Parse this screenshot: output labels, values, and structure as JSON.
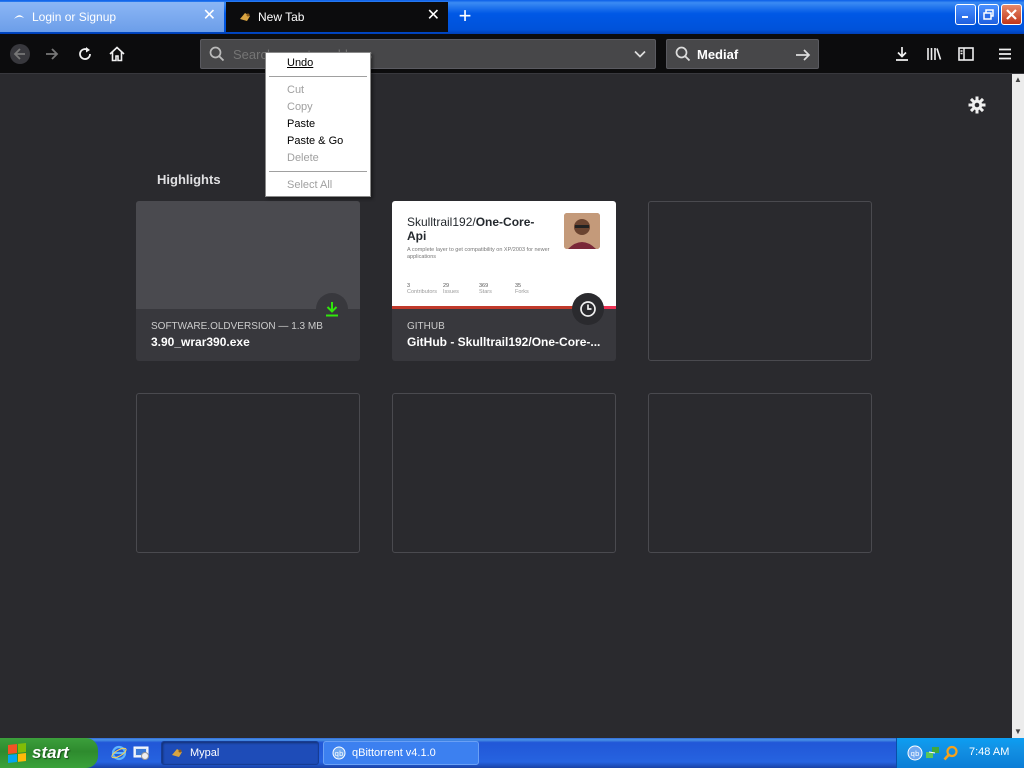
{
  "tabs": [
    {
      "label": "Login or Signup",
      "active": false
    },
    {
      "label": "New Tab",
      "active": true
    }
  ],
  "toolbar": {
    "address_placeholder": "Search or enter address",
    "search_value": "Mediaf"
  },
  "context_menu": {
    "items": [
      {
        "label": "Undo",
        "enabled": true
      },
      {
        "label": "Cut",
        "enabled": false
      },
      {
        "label": "Copy",
        "enabled": false
      },
      {
        "label": "Paste",
        "enabled": true
      },
      {
        "label": "Paste & Go",
        "enabled": true
      },
      {
        "label": "Delete",
        "enabled": false
      },
      {
        "label": "Select All",
        "enabled": false
      }
    ]
  },
  "highlights": {
    "title": "Highlights",
    "cards": [
      {
        "context": "SOFTWARE.OLDVERSION — 1.3 MB",
        "title": "3.90_wrar390.exe",
        "badge": "download-icon"
      },
      {
        "context": "GITHUB",
        "title": "GitHub - Skulltrail192/One-Core-...",
        "badge": "clock-icon",
        "preview": {
          "owner": "Skulltrail192/",
          "repo": "One-Core-Api",
          "description": "A complete layer to get compatibility on XP/2003 for newer applications",
          "stats": [
            {
              "n": "3",
              "label": "Contributors"
            },
            {
              "n": "29",
              "label": "Issues"
            },
            {
              "n": "369",
              "label": "Stars"
            },
            {
              "n": "35",
              "label": "Forks"
            }
          ]
        }
      }
    ]
  },
  "taskbar": {
    "start_label": "start",
    "tasks": [
      {
        "label": "Mypal",
        "active": true
      },
      {
        "label": "qBittorrent v4.1.0",
        "active": false
      }
    ],
    "clock": "7:48 AM"
  },
  "colors": {
    "content_bg": "#2a2a2e",
    "card_bg": "#38383d",
    "download_badge": "#30e60b",
    "xp_blue": "#0058e6"
  }
}
